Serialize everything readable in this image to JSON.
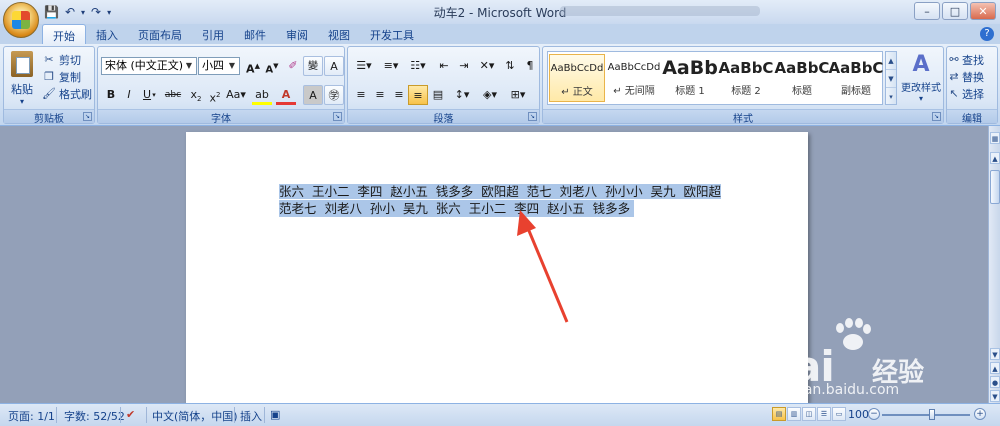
{
  "window": {
    "title": "动车2 - Microsoft Word"
  },
  "tabs": [
    "开始",
    "插入",
    "页面布局",
    "引用",
    "邮件",
    "审阅",
    "视图",
    "开发工具"
  ],
  "clipboard": {
    "paste": "粘贴",
    "cut": "剪切",
    "copy": "复制",
    "format_painter": "格式刷",
    "label": "剪贴板"
  },
  "font": {
    "name": "宋体 (中文正文)",
    "size": "小四",
    "label": "字体"
  },
  "paragraph": {
    "label": "段落"
  },
  "styles": {
    "items": [
      {
        "sample": "AaBbCcDd",
        "name": "↵ 正文"
      },
      {
        "sample": "AaBbCcDd",
        "name": "↵ 无间隔"
      },
      {
        "sample": "AaBb",
        "name": "标题 1"
      },
      {
        "sample": "AaBbC",
        "name": "标题 2"
      },
      {
        "sample": "AaBbC",
        "name": "标题"
      },
      {
        "sample": "AaBbC",
        "name": "副标题"
      }
    ],
    "change_styles": "更改样式",
    "label": "样式"
  },
  "editing": {
    "find": "查找",
    "replace": "替换",
    "select": "选择",
    "label": "编辑"
  },
  "document": {
    "line1": "张六  王小二  李四  赵小五  钱多多  欧阳超  范七  刘老八  孙小小  吴九  欧阳超",
    "line2": "范老七  刘老八  孙小  吴九  张六  王小二  李四  赵小五  钱多多 "
  },
  "status": {
    "page": "页面: 1/1",
    "words": "字数: 52/52",
    "language": "中文(简体，中国)",
    "mode": "插入",
    "zoom": "100%"
  },
  "watermark": {
    "brand": "Bai",
    "brand_cn": "经验",
    "url": "jingyan.baidu.com"
  },
  "colors": {
    "selection": "#abc6e8",
    "ribbon": "#dbe7f6",
    "arrow": "#e8412f"
  }
}
